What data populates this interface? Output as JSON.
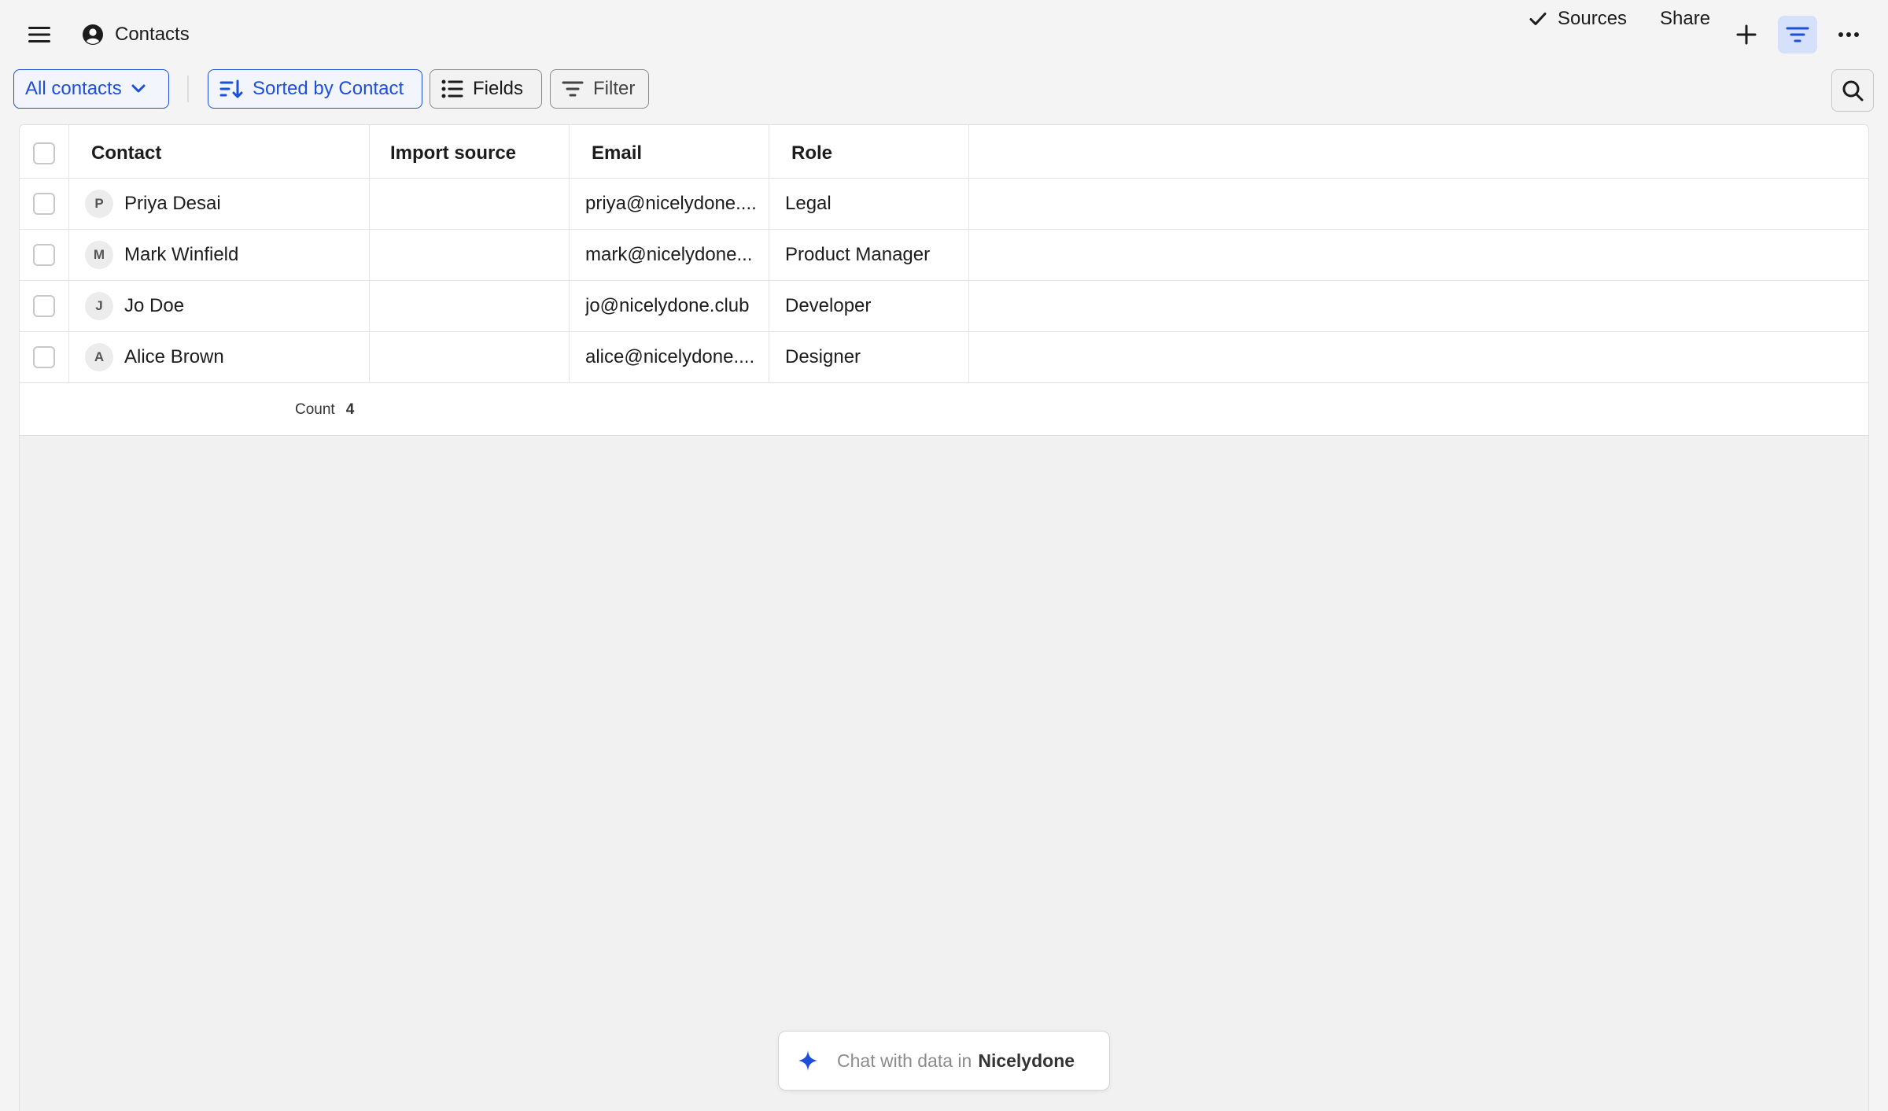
{
  "header": {
    "title": "Contacts",
    "sources_label": "Sources",
    "share_label": "Share"
  },
  "toolbar": {
    "view_label": "All contacts",
    "sort_label": "Sorted by Contact",
    "fields_label": "Fields",
    "filter_label": "Filter"
  },
  "table": {
    "columns": [
      "Contact",
      "Import source",
      "Email",
      "Role"
    ],
    "rows": [
      {
        "initial": "P",
        "contact": "Priya Desai",
        "import_source": "",
        "email": "priya@nicelydone....",
        "role": "Legal"
      },
      {
        "initial": "M",
        "contact": "Mark Winfield",
        "import_source": "",
        "email": "mark@nicelydone...",
        "role": "Product Manager"
      },
      {
        "initial": "J",
        "contact": "Jo Doe",
        "import_source": "",
        "email": "jo@nicelydone.club",
        "role": "Developer"
      },
      {
        "initial": "A",
        "contact": "Alice Brown",
        "import_source": "",
        "email": "alice@nicelydone....",
        "role": "Designer"
      }
    ],
    "footer": {
      "count_label": "Count",
      "count_value": "4"
    }
  },
  "chat": {
    "prefix": "Chat with data in",
    "brand": "Nicelydone"
  },
  "colors": {
    "accent": "#1e4fd8",
    "accent_bg": "#d5e0fb",
    "background": "#f4f4f4",
    "grid_bg": "#ffffff"
  },
  "icons": [
    "menu-icon",
    "user-circle-icon",
    "check-icon",
    "plus-icon",
    "filter-lines-icon",
    "more-horizontal-icon",
    "chevron-down-icon",
    "sort-icon",
    "list-icon",
    "search-icon",
    "sparkle-icon"
  ]
}
